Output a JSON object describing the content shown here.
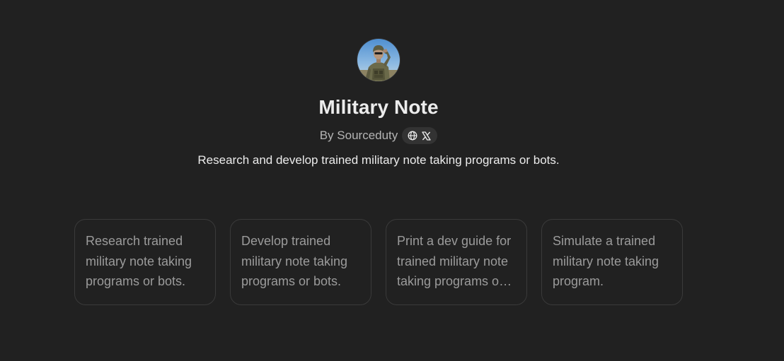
{
  "gpt": {
    "name": "Military Note",
    "byline": "By Sourceduty",
    "description": "Research and develop trained military note taking programs or bots.",
    "avatar_icon": "saluting-soldier-avatar"
  },
  "social_links": [
    {
      "icon": "globe-icon"
    },
    {
      "icon": "x-logo-icon"
    }
  ],
  "conversation_starters": [
    {
      "text": "Research trained military note taking programs or bots."
    },
    {
      "text": "Develop trained military note taking programs or bots."
    },
    {
      "text": "Print a dev guide for trained military note taking programs or bots."
    },
    {
      "text": "Simulate a trained military note taking program."
    }
  ],
  "colors": {
    "background": "#212121",
    "title": "#ececec",
    "muted_text": "#b4b4b4",
    "card_border": "#3a3a3a",
    "card_text": "#9b9b9b"
  }
}
